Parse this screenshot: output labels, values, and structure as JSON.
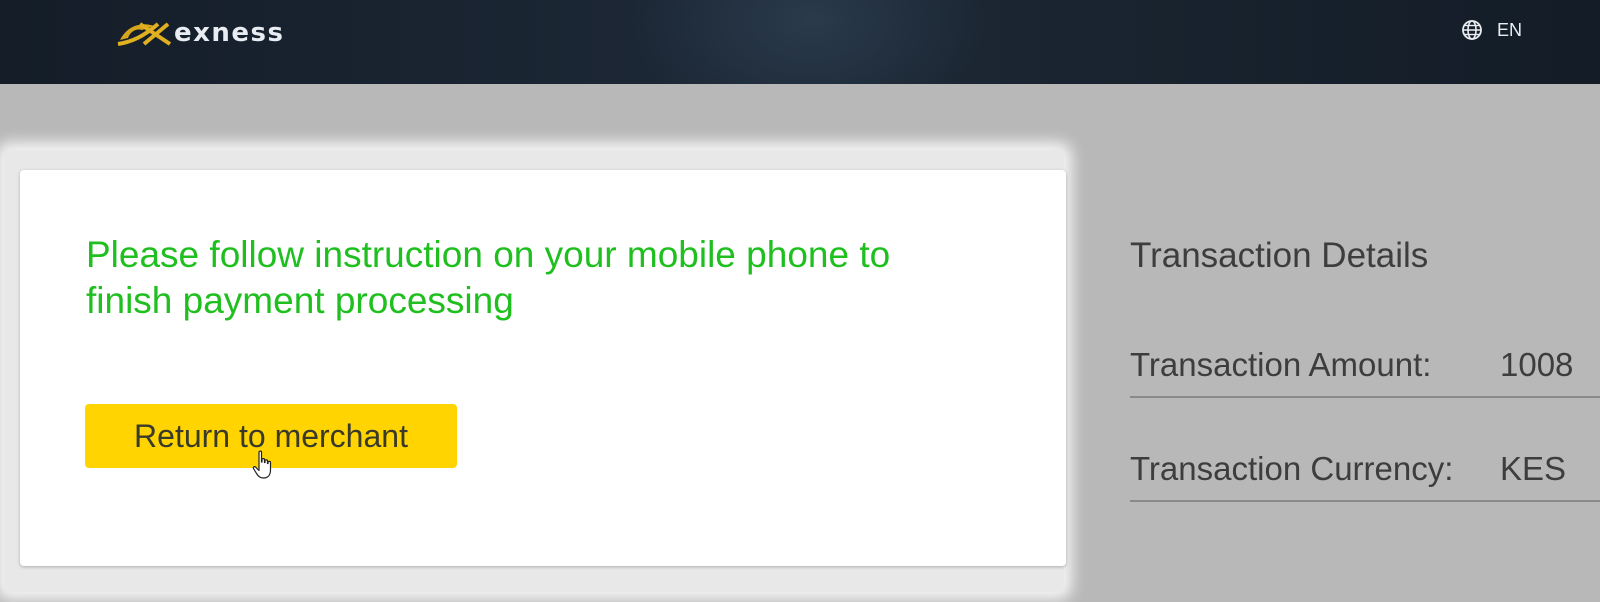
{
  "header": {
    "brand_name": "exness",
    "brand_color": "#e0b020",
    "language_icon": "globe-icon",
    "language_label": "EN"
  },
  "main": {
    "message": "Please follow instruction on your mobile phone to finish payment processing",
    "message_color": "#1fbf1f",
    "return_button_label": "Return to merchant",
    "return_button_color": "#ffd400"
  },
  "details": {
    "title": "Transaction Details",
    "rows": [
      {
        "label": "Transaction Amount:",
        "value": "1008"
      },
      {
        "label": "Transaction Currency:",
        "value": "KES"
      }
    ]
  },
  "cursor_icon": "hand-pointer-icon"
}
